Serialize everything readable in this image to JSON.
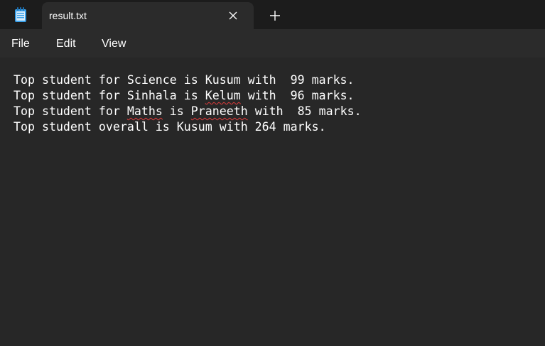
{
  "tab": {
    "title": "result.txt",
    "app_icon": "notepad-icon",
    "close_icon": "close-icon",
    "new_tab_icon": "plus-icon"
  },
  "menu": {
    "file": "File",
    "edit": "Edit",
    "view": "View"
  },
  "editor": {
    "lines": [
      {
        "segments": [
          {
            "text": "Top student for Science is Kusum with  99 marks.",
            "misspelled": false
          }
        ]
      },
      {
        "segments": [
          {
            "text": "Top student for Sinhala is ",
            "misspelled": false
          },
          {
            "text": "Kelum",
            "misspelled": true
          },
          {
            "text": " with  96 marks.",
            "misspelled": false
          }
        ]
      },
      {
        "segments": [
          {
            "text": "Top student for ",
            "misspelled": false
          },
          {
            "text": "Maths",
            "misspelled": true
          },
          {
            "text": " is ",
            "misspelled": false
          },
          {
            "text": "Praneeth",
            "misspelled": true
          },
          {
            "text": " with  85 marks.",
            "misspelled": false
          }
        ]
      },
      {
        "segments": [
          {
            "text": "Top student overall is Kusum with 264 marks.",
            "misspelled": false
          }
        ]
      }
    ]
  },
  "colors": {
    "titlebar_bg": "#1c1c1c",
    "tab_bg": "#2b2b2b",
    "editor_bg": "#272727",
    "text": "#ffffff",
    "spellcheck_underline": "#e03b3b",
    "icon_blue": "#3aa0e8"
  }
}
